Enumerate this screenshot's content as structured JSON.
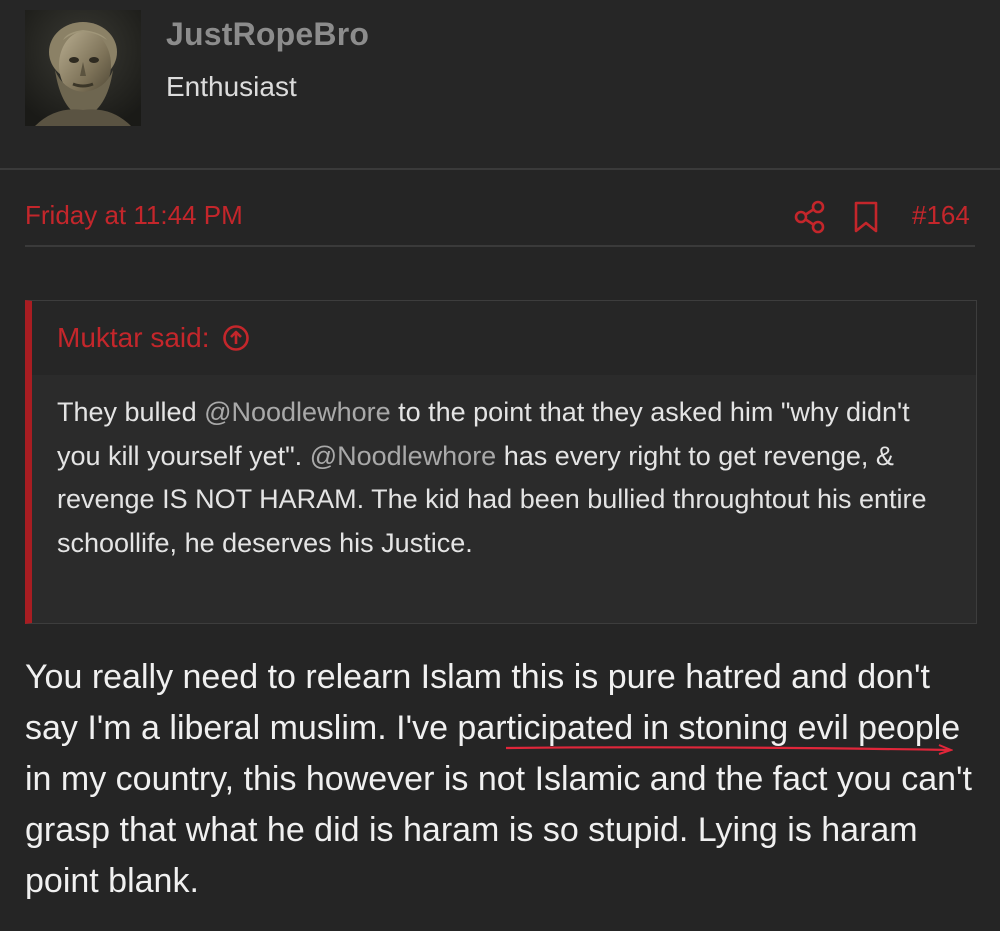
{
  "user": {
    "name": "JustRopeBro",
    "title": "Enthusiast"
  },
  "post": {
    "date": "Friday at 11:44 PM",
    "number": "#164",
    "icons": {
      "share": "share-icon",
      "bookmark": "bookmark-icon"
    }
  },
  "quote": {
    "author": "Muktar said:",
    "expand_icon": "arrow-up-circle-icon",
    "segments": {
      "s1": "They bulled ",
      "m1": "@Noodlewhore",
      "s2": " to the point that they asked him \"why didn't you kill yourself yet\". ",
      "m2": "@Noodlewhore",
      "s3": " has every right to get revenge, & revenge IS NOT HARAM. The kid had been bullied throughtout his entire schoollife, he deserves his Justice."
    }
  },
  "reply": {
    "text": "You really need to relearn Islam this is pure hatred and don't say I'm a liberal muslim. I've participated in stoning evil people in my country, this however is not Islamic and the fact you can't grasp that what he did is haram is so stupid. Lying is haram point blank."
  },
  "colors": {
    "accent": "#c4262b",
    "background": "#252525",
    "quote_border": "#a81d22",
    "annotation": "#e0263a"
  }
}
